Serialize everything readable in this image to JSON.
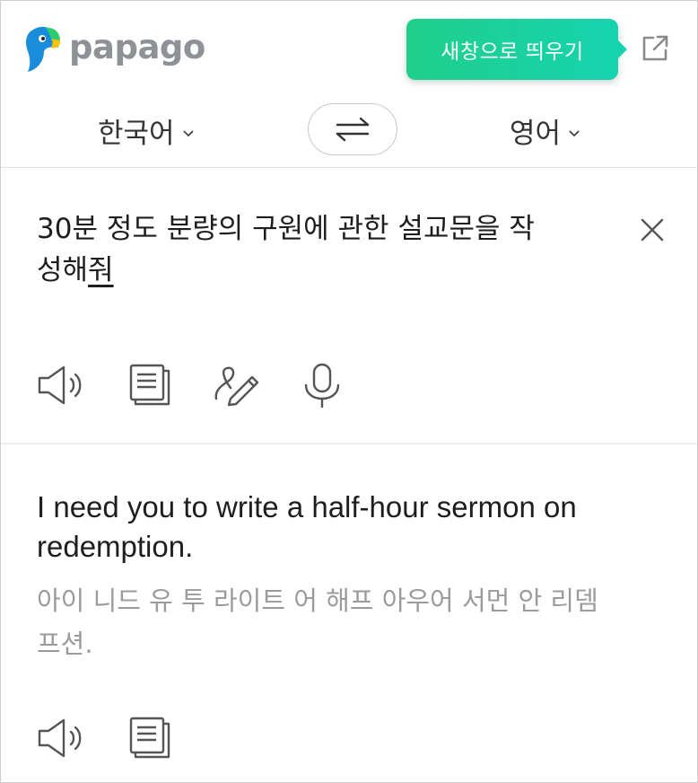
{
  "app": {
    "brand_name": "papago",
    "brand_colors": {
      "parrot_blue": "#1a8cdc",
      "parrot_green": "#2ecc71",
      "parrot_yellow": "#f5c400",
      "wordmark": "#8e9196"
    }
  },
  "header": {
    "tooltip_label": "새창으로 띄우기",
    "tooltip_color": "#19d19e",
    "popout_icon": "external-link-icon"
  },
  "langbar": {
    "source_lang": "한국어",
    "target_lang": "영어",
    "swap_icon": "swap-arrows-icon"
  },
  "source": {
    "text_main": "30분 정도 분량의 구원에 관한 설교문을 작\n성해",
    "text_underlined": "줘",
    "clear_icon": "close-icon",
    "tools": [
      "speaker-icon",
      "copy-icon",
      "handwriting-icon",
      "microphone-icon"
    ]
  },
  "target": {
    "translation": "I need you to write a half-hour sermon on redemption.",
    "pronunciation": "아이 니드 유 투 라이트 어 해프 아우어 서먼 안 리뎀프션.",
    "tools": [
      "speaker-icon",
      "copy-icon"
    ]
  }
}
